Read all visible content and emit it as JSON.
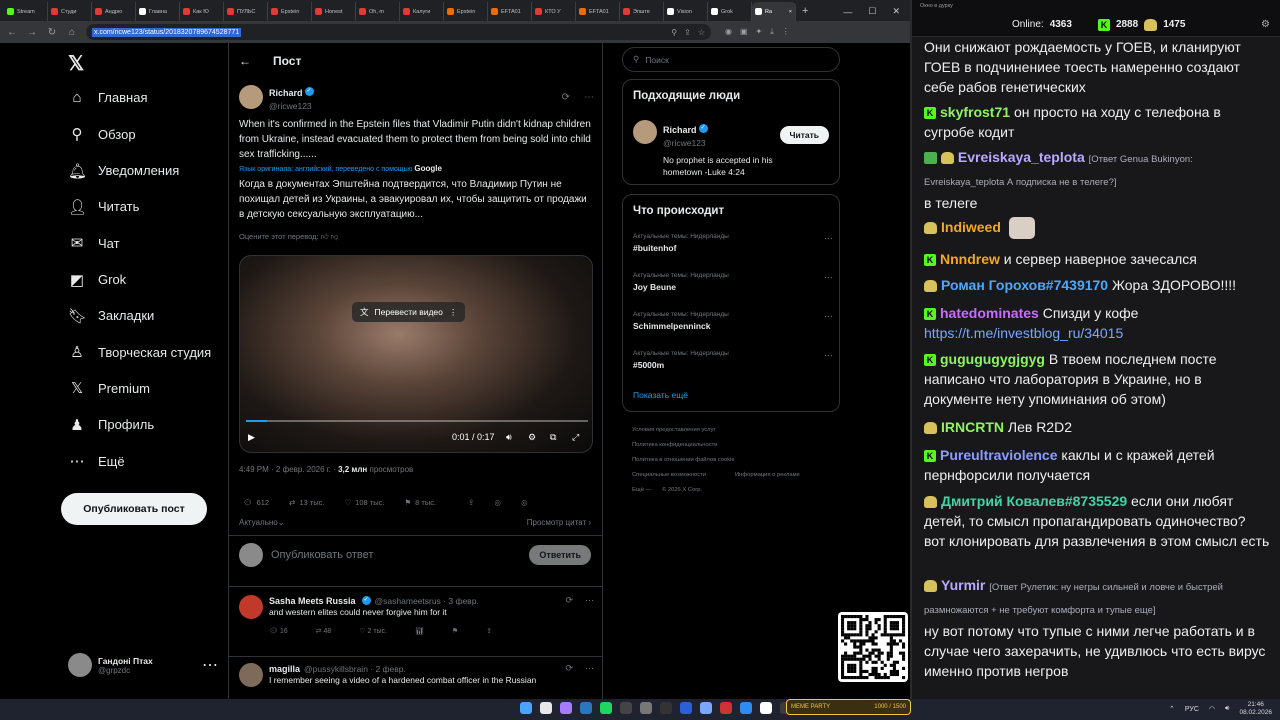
{
  "browser": {
    "tabs": [
      {
        "label": "Stream",
        "color": "#53fc18"
      },
      {
        "label": "Студи",
        "color": "#e53935"
      },
      {
        "label": "Андрю",
        "color": "#e53935"
      },
      {
        "label": "Главна",
        "color": "#ffffff"
      },
      {
        "label": "Как Ю",
        "color": "#e53935"
      },
      {
        "label": "ПУЛЬС",
        "color": "#e53935"
      },
      {
        "label": "Epstein",
        "color": "#e53935"
      },
      {
        "label": "Honest",
        "color": "#e53935"
      },
      {
        "label": "Oh, m",
        "color": "#e53935"
      },
      {
        "label": "Калуги",
        "color": "#e53935"
      },
      {
        "label": "Epstein",
        "color": "#ef6c00"
      },
      {
        "label": "EFTA01",
        "color": "#ef6c00"
      },
      {
        "label": "КТО У",
        "color": "#e53935"
      },
      {
        "label": "EFTA01",
        "color": "#ef6c00"
      },
      {
        "label": "Эпште",
        "color": "#e53935"
      },
      {
        "label": "Vision",
        "color": "#ffffff"
      },
      {
        "label": "Grok",
        "color": "#ffffff"
      },
      {
        "label": "Ra",
        "color": "#ffffff"
      }
    ],
    "url": "x.com/ricwe123/status/2018320789674528771"
  },
  "nav": {
    "items": [
      {
        "label": "Главная",
        "icon": "home-icon",
        "glyph": "⌂"
      },
      {
        "label": "Обзор",
        "icon": "search-icon",
        "glyph": "⚲"
      },
      {
        "label": "Уведомления",
        "icon": "bell-icon",
        "glyph": "🔔︎"
      },
      {
        "label": "Читать",
        "icon": "follow-icon",
        "glyph": "👤︎"
      },
      {
        "label": "Чат",
        "icon": "mail-icon",
        "glyph": "✉"
      },
      {
        "label": "Grok",
        "icon": "grok-icon",
        "glyph": "◩"
      },
      {
        "label": "Закладки",
        "icon": "bookmark-icon",
        "glyph": "🔖︎"
      },
      {
        "label": "Творческая студия",
        "icon": "studio-icon",
        "glyph": "♙"
      },
      {
        "label": "Premium",
        "icon": "x-premium-icon",
        "glyph": "𝕏"
      },
      {
        "label": "Профиль",
        "icon": "profile-icon",
        "glyph": "♟"
      },
      {
        "label": "Ещё",
        "icon": "more-icon",
        "glyph": "⋯"
      }
    ],
    "post_button": "Опубликовать пост",
    "profile": {
      "name": "Гандоні Птах",
      "handle": "@grpzdc"
    }
  },
  "main": {
    "header": "Пост",
    "tweet": {
      "name": "Richard",
      "handle": "@ricwe123",
      "text": "When it's confirmed in the Epstein files that Vladimir Putin didn't kidnap children from Ukraine, instead evacuated them to protect them from being sold into child sex trafficking......",
      "translate_note": "Язык оригинала: английский, переведено с помощью",
      "translate_brand": "Google",
      "translation": "Когда в документах Эпштейна подтвердится, что Владимир Путин не похищал детей из Украины, а эвакуировал их, чтобы защитить от продажи в детскую сексуальную эксплуатацию...",
      "rate": "Оцените этот перевод:",
      "video_pill": "Перевести видео",
      "video_time": "0:01 / 0:17",
      "video_progress": 0.06,
      "time": "4:49 PM · 2 февр. 2026 г. ·",
      "views": "3,2 млн",
      "views_label": "просмотров",
      "stats": {
        "replies": "612",
        "reposts": "13 тыс.",
        "likes": "108 тыс.",
        "bookmarks": "8 тыс."
      },
      "sort": "Актуально",
      "quotes": "Просмотр цитат"
    },
    "reply_placeholder": "Опубликовать ответ",
    "reply_button": "Ответить",
    "replies": [
      {
        "name": "Sasha Meets Russia",
        "handle": "@sashameetsrus · 3 февр.",
        "text": "and western elites could never forgive him for it",
        "stats": [
          "16",
          "48",
          "2 тыс.",
          ""
        ]
      },
      {
        "name": "magilla",
        "handle": "@pussykillsbrain · 2 февр.",
        "text": "I remember seeing a video of a hardened combat officer in the Russian"
      }
    ]
  },
  "right": {
    "search_placeholder": "Поиск",
    "people_title": "Подходящие люди",
    "person": {
      "name": "Richard",
      "handle": "@ricwe123",
      "bio": "No prophet is accepted in his hometown -Luke 4:24",
      "follow": "Читать"
    },
    "trends_title": "Что происходит",
    "trends": [
      {
        "cat": "Актуальные темы: Нидерланды",
        "name": "#buitenhof"
      },
      {
        "cat": "Актуальные темы: Нидерланды",
        "name": "Joy Beune"
      },
      {
        "cat": "Актуальные темы: Нидерланды",
        "name": "Schimmelpenninck"
      },
      {
        "cat": "Актуальные темы: Нидерланды",
        "name": "#5000m"
      }
    ],
    "show_more": "Показать ещё",
    "footer": [
      "Условия предоставления услуг",
      "Политика конфиденциальности",
      "Политика в отношении файлов cookie",
      "Специальные возможности",
      "Информация о рекламе",
      "Ещё —",
      "© 2026 X Corp."
    ]
  },
  "chat": {
    "window_title": "Окно в дурку",
    "online_label": "Online:",
    "online": "4363",
    "count_a": "2888",
    "count_b": "1475",
    "messages": [
      {
        "user": "",
        "text": "Они снижают рождаемость у ГОЕВ, и кланируют ГОЕВ в подчинениее тоесть намеренно создают себе рабов генетических",
        "color": "#efeff1"
      },
      {
        "user": "skyfrost71",
        "text": "он просто на ходу с телефона в сугробе кодит",
        "color": "#8ef55d"
      },
      {
        "user": "Evreiskaya_teplota",
        "reply": "[Ответ Genua Bukinyon: Evreiskaya_teplota А подписка не в телеге?]",
        "text": "в телеге",
        "color": "#b9a9ff"
      },
      {
        "user": "Indiweed",
        "text": "",
        "color": "#f5a623"
      },
      {
        "user": "Nnndrew",
        "text": "и сервер наверное зачесался",
        "color": "#f5a623"
      },
      {
        "user": "Роман Горохов#7439170",
        "text": "Жора ЗДОРОВО!!!!",
        "color": "#4aa8ff"
      },
      {
        "user": "hatedominates",
        "text": "Спизди у кофе",
        "link": "https://t.me/investblog_ru/34015",
        "color": "#c86cff"
      },
      {
        "user": "gugugugygjgyg",
        "text": "В твоем последнем посте написано что лаборатория в Украине, но в документе нету упоминания об этом)",
        "color": "#8ef55d"
      },
      {
        "user": "IRNCRTN",
        "text": "Лев R2D2",
        "color": "#8ef55d"
      },
      {
        "user": "Pureultraviolence",
        "text": "каклы и с кражей детей пернфорсили получается",
        "color": "#8a9cff"
      },
      {
        "user": "Дмитрий Ковалев#8735529",
        "text": "если они любят детей, то смысл пропагандировать одиночество? вот клонировать для развлечения в этом смысл есть",
        "color": "#3fd6a6"
      },
      {
        "user": "Yurmir",
        "reply": "[Ответ Рулетик: ну негры сильней и ловче и быстрей размножаются + не требуют комфорта и тупые еще]",
        "text": "ну вот потому что тупые с ними легче работать и в случае чего захерачить, не удивлюсь что есть вирус именно против негров",
        "color": "#b9a9ff"
      }
    ]
  },
  "taskbar": {
    "meme_label": "MEME PARTY",
    "meme_counter": "1000 / 1500",
    "lang": "РУС",
    "time": "21:46",
    "date": "08.02.2026"
  }
}
